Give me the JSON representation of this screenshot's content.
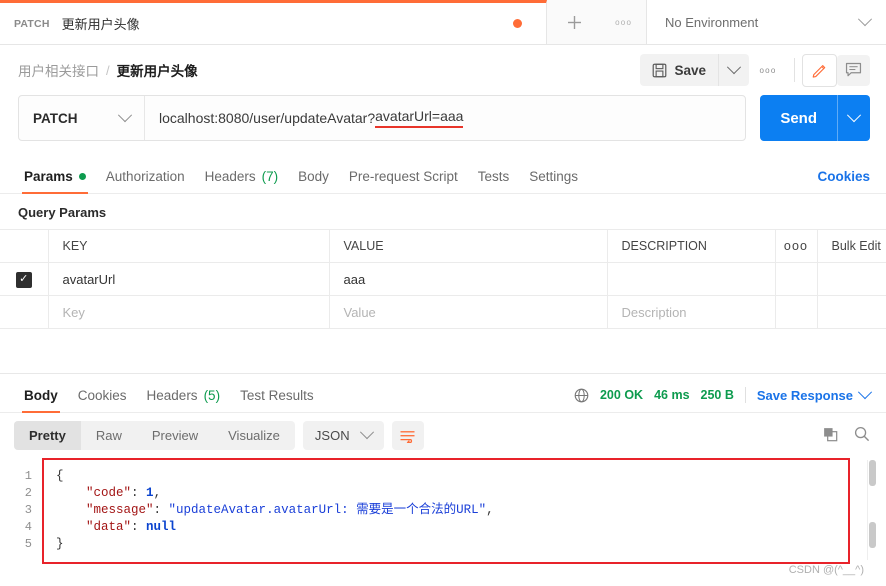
{
  "tabbar": {
    "request_tab": {
      "method": "PATCH",
      "name": "更新用户头像"
    },
    "new_tab_icon": "plus-icon",
    "tab_options_icon": "ellipsis-icon",
    "environment": {
      "label": "No Environment"
    }
  },
  "breadcrumb": {
    "parent": "用户相关接口",
    "separator": "/",
    "current": "更新用户头像"
  },
  "toolbar": {
    "save_label": "Save",
    "save_caret": "chevron-down-icon",
    "more_label": "ooo",
    "edit_icon": "pencil-icon",
    "comment_icon": "comment-icon"
  },
  "url_row": {
    "method": "PATCH",
    "url_prefix": "localhost:8080/user/updateAvatar?",
    "url_highlighted": "avatarUrl=aaa",
    "send_label": "Send",
    "highlight_color": "#e8352a"
  },
  "request_tabs": {
    "items": [
      {
        "label": "Params",
        "badge": "dot",
        "active": true
      },
      {
        "label": "Authorization",
        "badge": "",
        "active": false
      },
      {
        "label": "Headers",
        "badge": "(7)",
        "active": false
      },
      {
        "label": "Body",
        "badge": "",
        "active": false
      },
      {
        "label": "Pre-request Script",
        "badge": "",
        "active": false
      },
      {
        "label": "Tests",
        "badge": "",
        "active": false
      },
      {
        "label": "Settings",
        "badge": "",
        "active": false
      }
    ],
    "cookies_link": "Cookies"
  },
  "query_params": {
    "section_title": "Query Params",
    "headers": {
      "key": "KEY",
      "value": "VALUE",
      "description": "DESCRIPTION",
      "options": "ooo",
      "bulk_edit": "Bulk Edit"
    },
    "rows": [
      {
        "checked": true,
        "key": "avatarUrl",
        "value": "aaa",
        "description": ""
      }
    ],
    "placeholder_row": {
      "key": "Key",
      "value": "Value",
      "description": "Description"
    }
  },
  "response": {
    "tabs": [
      {
        "label": "Body",
        "badge": "",
        "active": true
      },
      {
        "label": "Cookies",
        "badge": "",
        "active": false
      },
      {
        "label": "Headers",
        "badge": "(5)",
        "active": false
      },
      {
        "label": "Test Results",
        "badge": "",
        "active": false
      }
    ],
    "meta": {
      "globe_icon": "globe-icon",
      "status": "200 OK",
      "time": "46 ms",
      "size": "250 B",
      "save_response": "Save Response",
      "status_color": "#0d9b4e"
    },
    "viewer": {
      "modes": [
        "Pretty",
        "Raw",
        "Preview",
        "Visualize"
      ],
      "active_mode": "Pretty",
      "format": "JSON",
      "wrap_icon": "wrap-lines-icon",
      "copy_icon": "copy-icon",
      "search_icon": "search-icon"
    },
    "body": {
      "line_numbers": [
        "1",
        "2",
        "3",
        "4",
        "5"
      ],
      "lines": [
        {
          "tokens": [
            {
              "t": "p",
              "v": "{"
            }
          ]
        },
        {
          "tokens": [
            {
              "t": "p",
              "v": "    "
            },
            {
              "t": "k",
              "v": "\"code\""
            },
            {
              "t": "p",
              "v": ": "
            },
            {
              "t": "n",
              "v": "1"
            },
            {
              "t": "p",
              "v": ","
            }
          ]
        },
        {
          "tokens": [
            {
              "t": "p",
              "v": "    "
            },
            {
              "t": "k",
              "v": "\"message\""
            },
            {
              "t": "p",
              "v": ": "
            },
            {
              "t": "s",
              "v": "\"updateAvatar.avatarUrl: 需要是一个合法的URL\""
            },
            {
              "t": "p",
              "v": ","
            }
          ]
        },
        {
          "tokens": [
            {
              "t": "p",
              "v": "    "
            },
            {
              "t": "k",
              "v": "\"data\""
            },
            {
              "t": "p",
              "v": ": "
            },
            {
              "t": "n",
              "v": "null"
            }
          ]
        },
        {
          "tokens": [
            {
              "t": "p",
              "v": "}"
            }
          ]
        }
      ],
      "highlight_border_color": "#e8232a"
    }
  },
  "watermark": "CSDN @(^__^)"
}
